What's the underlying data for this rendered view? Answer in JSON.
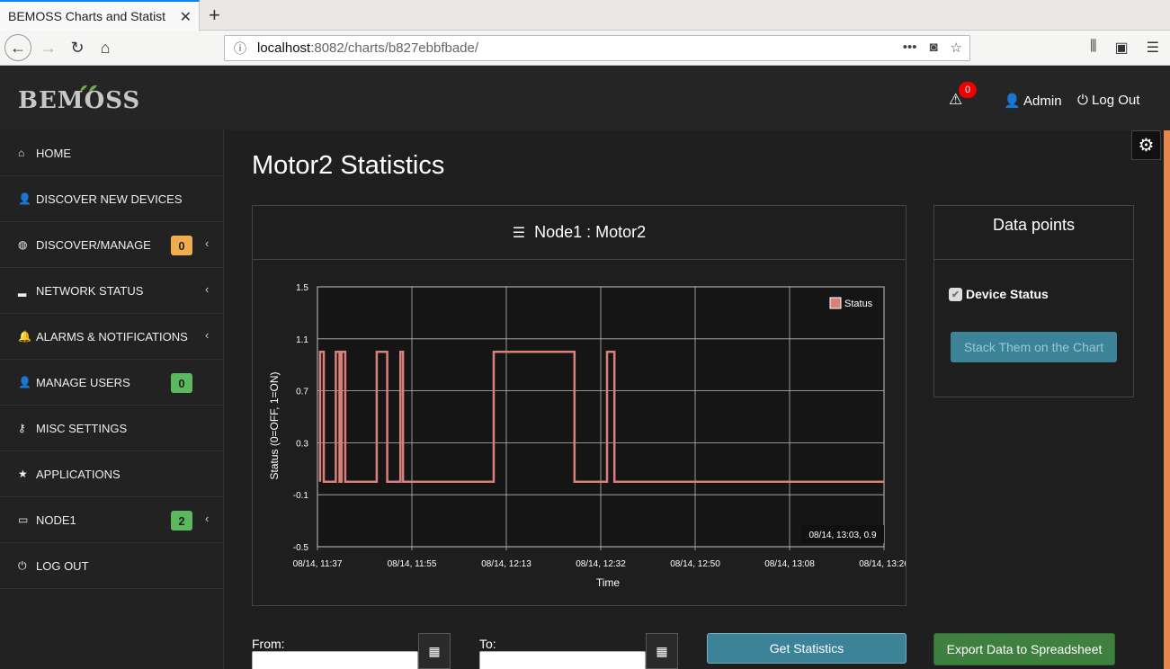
{
  "browser": {
    "tab_title": "BEMOSS Charts and Statist",
    "url_host": "localhost",
    "url_rest": ":8082/charts/b827ebbfbade/"
  },
  "header": {
    "logo": "BEMOSS",
    "alert_count": "0",
    "admin_label": "Admin",
    "logout_label": "Log Out"
  },
  "sidebar": {
    "items": [
      {
        "label": "HOME",
        "icon": "home-icon"
      },
      {
        "label": "DISCOVER NEW DEVICES",
        "icon": "user-icon"
      },
      {
        "label": "DISCOVER/MANAGE",
        "icon": "globe-icon",
        "badge": "0",
        "badge_color": "#f0ad4e"
      },
      {
        "label": "NETWORK STATUS",
        "icon": "signal-icon"
      },
      {
        "label": "ALARMS & NOTIFICATIONS",
        "icon": "bell-icon"
      },
      {
        "label": "MANAGE USERS",
        "icon": "user-icon",
        "badge": "0",
        "badge_color": "#5cb85c"
      },
      {
        "label": "MISC SETTINGS",
        "icon": "key-icon"
      },
      {
        "label": "APPLICATIONS",
        "icon": "star-icon"
      },
      {
        "label": "NODE1",
        "icon": "monitor-icon",
        "badge": "2",
        "badge_color": "#5cb85c"
      },
      {
        "label": "LOG OUT",
        "icon": "power-icon"
      }
    ]
  },
  "main": {
    "page_title": "Motor2 Statistics",
    "chart_panel_title": "Node1 : Motor2",
    "data_points_title": "Data points",
    "device_status_label": "Device Status",
    "stack_button": "Stack Them on the Chart",
    "from_label": "From:",
    "to_label": "To:",
    "get_stats_button": "Get Statistics",
    "export_button": "Export Data to Spreadsheet"
  },
  "chart_data": {
    "type": "line",
    "ylabel": "Status (0=OFF, 1=ON)",
    "xlabel": "Time",
    "legend": [
      "Status"
    ],
    "legend_position": "top-right",
    "series_color": "#d9807a",
    "y_ticks": [
      "1.5",
      "1.1",
      "0.7",
      "0.3",
      "-0.1",
      "-0.5"
    ],
    "ylim": [
      -0.5,
      1.5
    ],
    "x_ticks": [
      "08/14, 11:37",
      "08/14, 11:55",
      "08/14, 12:13",
      "08/14, 12:32",
      "08/14, 12:50",
      "08/14, 13:08",
      "08/14, 13:26"
    ],
    "xlim": [
      0,
      108
    ],
    "tooltip": "08/14, 13:03, 0.9",
    "grid": true,
    "series": [
      {
        "name": "Status",
        "points": [
          [
            0.5,
            0
          ],
          [
            0.5,
            1
          ],
          [
            1.2,
            1
          ],
          [
            1.2,
            0
          ],
          [
            3.5,
            0
          ],
          [
            3.5,
            1
          ],
          [
            4.2,
            1
          ],
          [
            4.2,
            0
          ],
          [
            4.6,
            0
          ],
          [
            4.6,
            1
          ],
          [
            5.3,
            1
          ],
          [
            5.3,
            0
          ],
          [
            11.3,
            0
          ],
          [
            11.3,
            1
          ],
          [
            13.3,
            1
          ],
          [
            13.3,
            0
          ],
          [
            15.8,
            0
          ],
          [
            15.8,
            1
          ],
          [
            16.3,
            1
          ],
          [
            16.3,
            0
          ],
          [
            33.6,
            0
          ],
          [
            33.6,
            1
          ],
          [
            49,
            1
          ],
          [
            49,
            0
          ],
          [
            55.2,
            0
          ],
          [
            55.2,
            1
          ],
          [
            56.6,
            1
          ],
          [
            56.6,
            0
          ],
          [
            108,
            0
          ]
        ]
      }
    ]
  }
}
